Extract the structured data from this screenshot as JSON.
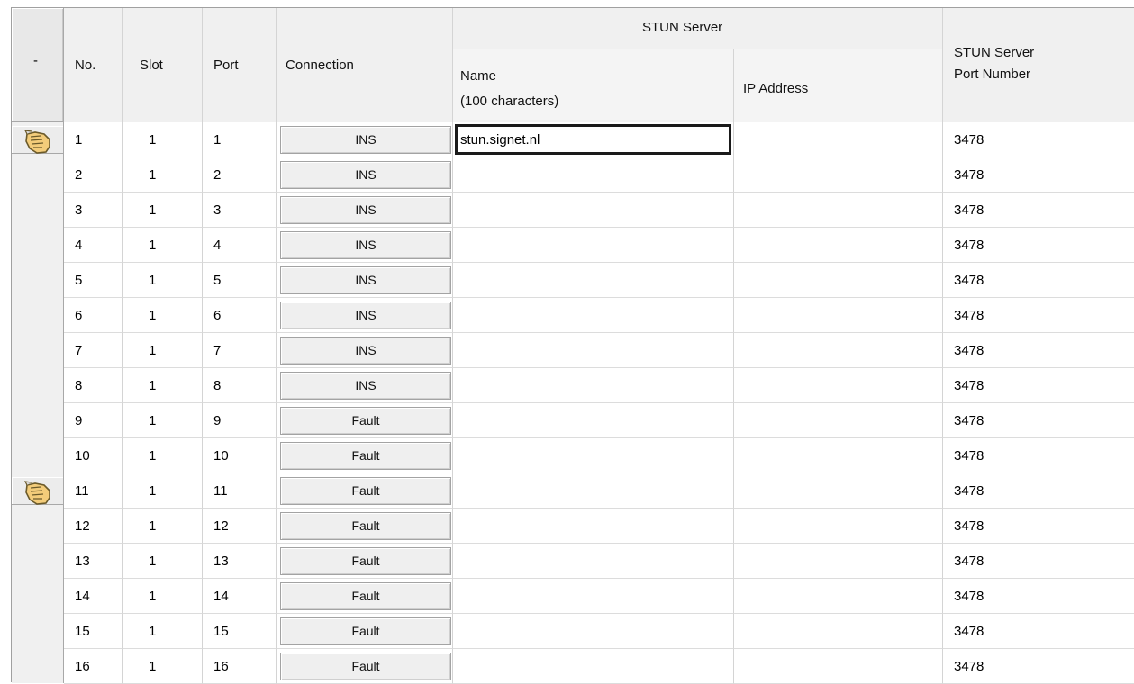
{
  "header": {
    "select_label": "-",
    "no": "No.",
    "slot": "Slot",
    "port": "Port",
    "connection": "Connection",
    "stun_server": "STUN Server",
    "name_line1": "Name",
    "name_line2": "(100 characters)",
    "ip_address": "IP Address",
    "stun_port_line1": "STUN Server",
    "stun_port_line2": "Port Number"
  },
  "rows": [
    {
      "no": "1",
      "slot": "1",
      "port": "1",
      "connection": "INS",
      "name": "stun.signet.nl",
      "ip": "",
      "stun_port": "3478",
      "selected": true,
      "name_active": true
    },
    {
      "no": "2",
      "slot": "1",
      "port": "2",
      "connection": "INS",
      "name": "",
      "ip": "",
      "stun_port": "3478",
      "selected": false
    },
    {
      "no": "3",
      "slot": "1",
      "port": "3",
      "connection": "INS",
      "name": "",
      "ip": "",
      "stun_port": "3478",
      "selected": false
    },
    {
      "no": "4",
      "slot": "1",
      "port": "4",
      "connection": "INS",
      "name": "",
      "ip": "",
      "stun_port": "3478",
      "selected": false
    },
    {
      "no": "5",
      "slot": "1",
      "port": "5",
      "connection": "INS",
      "name": "",
      "ip": "",
      "stun_port": "3478",
      "selected": false
    },
    {
      "no": "6",
      "slot": "1",
      "port": "6",
      "connection": "INS",
      "name": "",
      "ip": "",
      "stun_port": "3478",
      "selected": false
    },
    {
      "no": "7",
      "slot": "1",
      "port": "7",
      "connection": "INS",
      "name": "",
      "ip": "",
      "stun_port": "3478",
      "selected": false
    },
    {
      "no": "8",
      "slot": "1",
      "port": "8",
      "connection": "INS",
      "name": "",
      "ip": "",
      "stun_port": "3478",
      "selected": false
    },
    {
      "no": "9",
      "slot": "1",
      "port": "9",
      "connection": "Fault",
      "name": "",
      "ip": "",
      "stun_port": "3478",
      "selected": false
    },
    {
      "no": "10",
      "slot": "1",
      "port": "10",
      "connection": "Fault",
      "name": "",
      "ip": "",
      "stun_port": "3478",
      "selected": false
    },
    {
      "no": "11",
      "slot": "1",
      "port": "11",
      "connection": "Fault",
      "name": "",
      "ip": "",
      "stun_port": "3478",
      "selected": true
    },
    {
      "no": "12",
      "slot": "1",
      "port": "12",
      "connection": "Fault",
      "name": "",
      "ip": "",
      "stun_port": "3478",
      "selected": false
    },
    {
      "no": "13",
      "slot": "1",
      "port": "13",
      "connection": "Fault",
      "name": "",
      "ip": "",
      "stun_port": "3478",
      "selected": false
    },
    {
      "no": "14",
      "slot": "1",
      "port": "14",
      "connection": "Fault",
      "name": "",
      "ip": "",
      "stun_port": "3478",
      "selected": false
    },
    {
      "no": "15",
      "slot": "1",
      "port": "15",
      "connection": "Fault",
      "name": "",
      "ip": "",
      "stun_port": "3478",
      "selected": false
    },
    {
      "no": "16",
      "slot": "1",
      "port": "16",
      "connection": "Fault",
      "name": "",
      "ip": "",
      "stun_port": "3478",
      "selected": false
    }
  ],
  "icons": {
    "row_pointer": "hand-pointer-icon"
  }
}
